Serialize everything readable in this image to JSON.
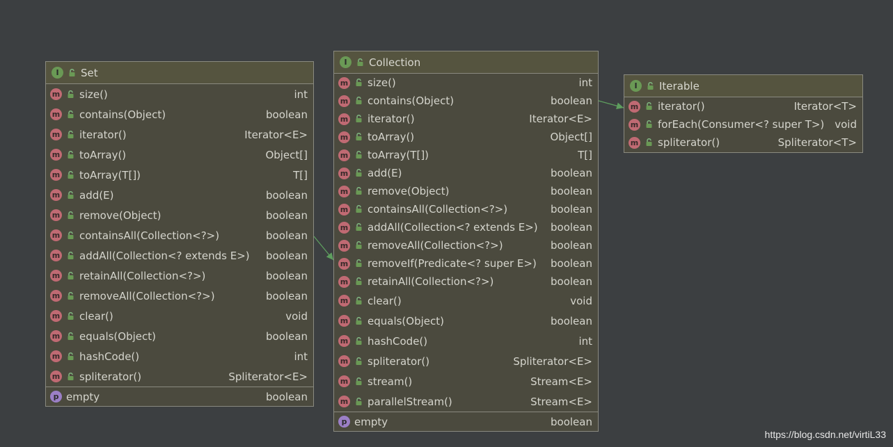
{
  "set": {
    "title": "Set",
    "methods": [
      {
        "name": "size()",
        "type": "int"
      },
      {
        "name": "contains(Object)",
        "type": "boolean"
      },
      {
        "name": "iterator()",
        "type": "Iterator<E>"
      },
      {
        "name": "toArray()",
        "type": "Object[]"
      },
      {
        "name": "toArray(T[])",
        "type": "T[]"
      },
      {
        "name": "add(E)",
        "type": "boolean"
      },
      {
        "name": "remove(Object)",
        "type": "boolean"
      },
      {
        "name": "containsAll(Collection<?>)",
        "type": "boolean"
      },
      {
        "name": "addAll(Collection<? extends E>)",
        "type": "boolean"
      },
      {
        "name": "retainAll(Collection<?>)",
        "type": "boolean"
      },
      {
        "name": "removeAll(Collection<?>)",
        "type": "boolean"
      },
      {
        "name": "clear()",
        "type": "void"
      },
      {
        "name": "equals(Object)",
        "type": "boolean"
      },
      {
        "name": "hashCode()",
        "type": "int"
      },
      {
        "name": "spliterator()",
        "type": "Spliterator<E>"
      }
    ],
    "fields": [
      {
        "name": "empty",
        "type": "boolean"
      }
    ]
  },
  "collection": {
    "title": "Collection",
    "methods": [
      {
        "name": "size()",
        "type": "int"
      },
      {
        "name": "contains(Object)",
        "type": "boolean"
      },
      {
        "name": "iterator()",
        "type": "Iterator<E>"
      },
      {
        "name": "toArray()",
        "type": "Object[]"
      },
      {
        "name": "toArray(T[])",
        "type": "T[]"
      },
      {
        "name": "add(E)",
        "type": "boolean"
      },
      {
        "name": "remove(Object)",
        "type": "boolean"
      },
      {
        "name": "containsAll(Collection<?>)",
        "type": "boolean"
      },
      {
        "name": "addAll(Collection<? extends E>)",
        "type": "boolean"
      },
      {
        "name": "removeAll(Collection<?>)",
        "type": "boolean"
      },
      {
        "name": "removeIf(Predicate<? super E>)",
        "type": "boolean"
      },
      {
        "name": "retainAll(Collection<?>)",
        "type": "boolean"
      },
      {
        "name": "clear()",
        "type": "void"
      },
      {
        "name": "equals(Object)",
        "type": "boolean"
      },
      {
        "name": "hashCode()",
        "type": "int"
      },
      {
        "name": "spliterator()",
        "type": "Spliterator<E>"
      },
      {
        "name": "stream()",
        "type": "Stream<E>"
      },
      {
        "name": "parallelStream()",
        "type": "Stream<E>"
      }
    ],
    "fields": [
      {
        "name": "empty",
        "type": "boolean"
      }
    ]
  },
  "iterable": {
    "title": "Iterable",
    "methods": [
      {
        "name": "iterator()",
        "type": "Iterator<T>"
      },
      {
        "name": "forEach(Consumer<? super T>)",
        "type": "void"
      },
      {
        "name": "spliterator()",
        "type": "Spliterator<T>"
      }
    ],
    "fields": []
  },
  "icons": {
    "interface_letter": "I",
    "method_letter": "m",
    "property_letter": "p"
  },
  "colors": {
    "background": "#3c3f41",
    "node_fill": "#4b4a3e",
    "node_border": "#8a8a80",
    "interface_icon": "#6a9955",
    "method_icon": "#c06a73",
    "property_icon": "#9b7fc6",
    "arrow": "#5e9e5e"
  },
  "watermark": "https://blog.csdn.net/virtiL33"
}
